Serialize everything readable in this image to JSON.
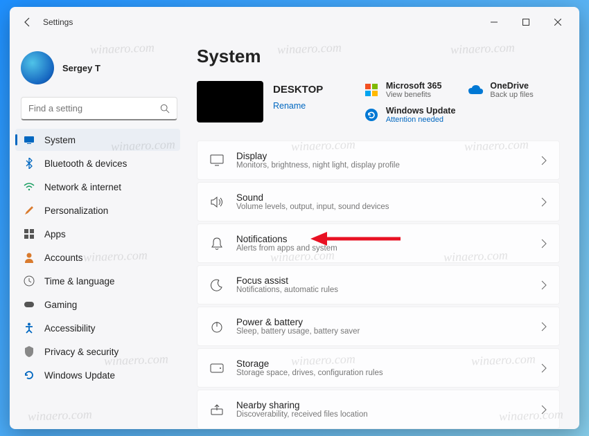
{
  "window": {
    "title": "Settings"
  },
  "user": {
    "name": "Sergey T"
  },
  "search": {
    "placeholder": "Find a setting"
  },
  "nav": [
    {
      "label": "System",
      "active": true
    },
    {
      "label": "Bluetooth & devices"
    },
    {
      "label": "Network & internet"
    },
    {
      "label": "Personalization"
    },
    {
      "label": "Apps"
    },
    {
      "label": "Accounts"
    },
    {
      "label": "Time & language"
    },
    {
      "label": "Gaming"
    },
    {
      "label": "Accessibility"
    },
    {
      "label": "Privacy & security"
    },
    {
      "label": "Windows Update"
    }
  ],
  "page": {
    "heading": "System",
    "device_name": "DESKTOP",
    "rename": "Rename"
  },
  "tiles": {
    "ms365": {
      "title": "Microsoft 365",
      "sub": "View benefits"
    },
    "onedrive": {
      "title": "OneDrive",
      "sub": "Back up files"
    },
    "update": {
      "title": "Windows Update",
      "sub": "Attention needed"
    }
  },
  "cards": [
    {
      "title": "Display",
      "sub": "Monitors, brightness, night light, display profile"
    },
    {
      "title": "Sound",
      "sub": "Volume levels, output, input, sound devices"
    },
    {
      "title": "Notifications",
      "sub": "Alerts from apps and system"
    },
    {
      "title": "Focus assist",
      "sub": "Notifications, automatic rules"
    },
    {
      "title": "Power & battery",
      "sub": "Sleep, battery usage, battery saver"
    },
    {
      "title": "Storage",
      "sub": "Storage space, drives, configuration rules"
    },
    {
      "title": "Nearby sharing",
      "sub": "Discoverability, received files location"
    }
  ],
  "watermark_text": "winaero.com"
}
